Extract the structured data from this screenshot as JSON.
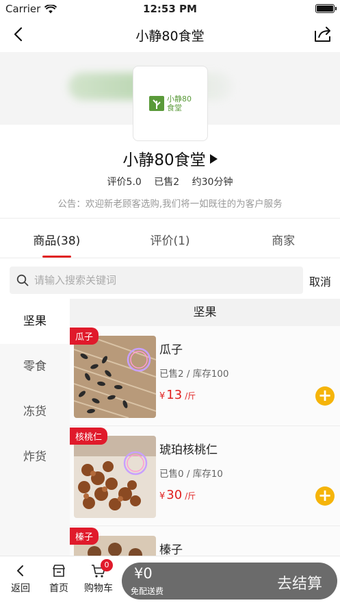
{
  "status": {
    "carrier": "Carrier",
    "time": "12:53 PM"
  },
  "nav": {
    "title": "小静80食堂"
  },
  "shop": {
    "logo_line1": "小静80",
    "logo_line2": "食堂",
    "name": "小静80食堂",
    "rating": "评价5.0",
    "sold": "已售2",
    "eta": "约30分钟",
    "notice": "公告：欢迎新老顾客选购,我们将一如既往的为客户服务"
  },
  "tabs": [
    {
      "label": "商品(38)",
      "active": true
    },
    {
      "label": "评价(1)",
      "active": false
    },
    {
      "label": "商家",
      "active": false
    }
  ],
  "search": {
    "placeholder": "请输入搜索关键词",
    "cancel_label": "取消"
  },
  "categories": [
    {
      "label": "坚果",
      "active": true
    },
    {
      "label": "零食",
      "active": false
    },
    {
      "label": "冻货",
      "active": false
    },
    {
      "label": "炸货",
      "active": false
    }
  ],
  "list": {
    "header": "坚果",
    "items": [
      {
        "tag": "瓜子",
        "name": "瓜子",
        "meta": "已售2 / 库存100",
        "currency": "¥",
        "price": "13",
        "unit": "/斤",
        "add": "+"
      },
      {
        "tag": "核桃仁",
        "name": "琥珀核桃仁",
        "meta": "已售0 / 库存10",
        "currency": "¥",
        "price": "30",
        "unit": "/斤",
        "add": "+"
      },
      {
        "tag": "榛子",
        "name": "榛子",
        "meta": "",
        "currency": "",
        "price": "",
        "unit": "",
        "add": ""
      }
    ]
  },
  "bottom": {
    "back_label": "返回",
    "home_label": "首页",
    "cart_label": "购物车",
    "cart_count": "0",
    "amount": "¥0",
    "free_delivery": "免配送费",
    "checkout_label": "去结算"
  },
  "colors": {
    "accent": "#e01a2b",
    "add_button": "#f5b40a",
    "cart_bar": "#6b6b6b"
  }
}
